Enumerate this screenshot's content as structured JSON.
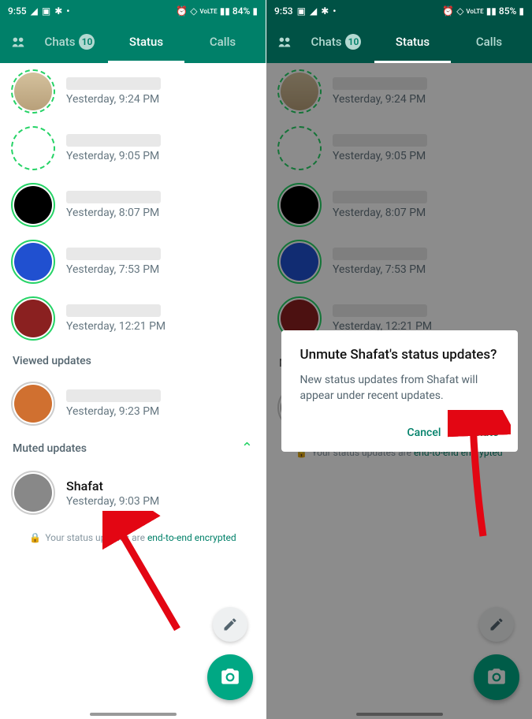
{
  "left": {
    "statusbar": {
      "time": "9:55",
      "battery": "84%"
    },
    "tabs": {
      "chats": "Chats",
      "chats_badge": "10",
      "status": "Status",
      "calls": "Calls"
    },
    "statuses": [
      {
        "time": "Yesterday, 9:24 PM",
        "ring": "dashed",
        "av": "av-bag"
      },
      {
        "time": "Yesterday, 9:05 PM",
        "ring": "dashed",
        "av": "av-text"
      },
      {
        "time": "Yesterday, 8:07 PM",
        "ring": "solid",
        "av": "av-black"
      },
      {
        "time": "Yesterday, 7:53 PM",
        "ring": "solid",
        "av": "av-blue"
      },
      {
        "time": "Yesterday, 12:21 PM",
        "ring": "solid",
        "av": "av-red"
      }
    ],
    "viewed_header": "Viewed updates",
    "viewed": [
      {
        "time": "Yesterday, 9:23 PM",
        "av": "av-orange"
      }
    ],
    "muted_header": "Muted updates",
    "muted": [
      {
        "name": "Shafat",
        "time": "Yesterday, 9:03 PM",
        "av": "av-grey"
      }
    ],
    "footer": {
      "pre": "Your status updates are ",
      "link": "end-to-end encrypted"
    }
  },
  "right": {
    "statusbar": {
      "time": "9:53",
      "battery": "85%"
    },
    "dialog": {
      "title": "Unmute Shafat's status updates?",
      "body": "New status updates from Shafat will appear under recent updates.",
      "cancel": "Cancel",
      "confirm": "Unmute"
    }
  }
}
